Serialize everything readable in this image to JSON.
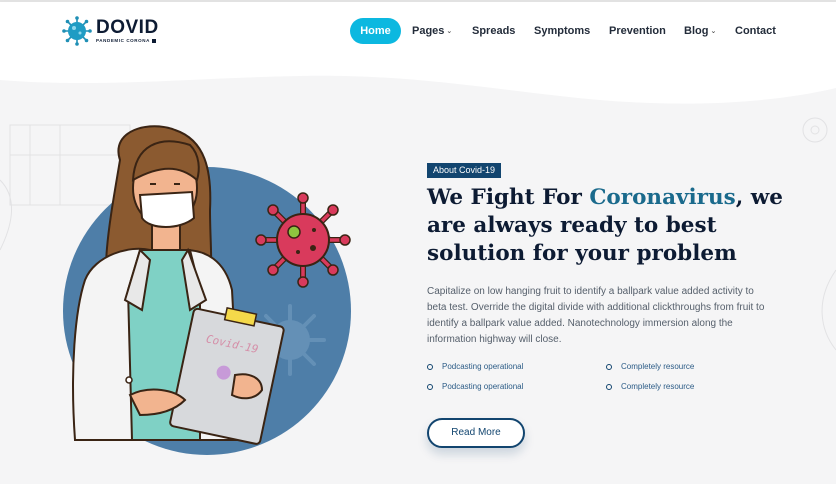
{
  "brand": {
    "name": "DOVID",
    "tagline": "PANDEMIC CORONA"
  },
  "nav": {
    "items": [
      {
        "label": "Home",
        "active": true
      },
      {
        "label": "Pages",
        "dropdown": true
      },
      {
        "label": "Spreads"
      },
      {
        "label": "Symptoms"
      },
      {
        "label": "Prevention"
      },
      {
        "label": "Blog",
        "dropdown": true
      },
      {
        "label": "Contact"
      }
    ]
  },
  "hero": {
    "tag": "About Covid-19",
    "title_before": "We Fight For ",
    "title_highlight": "Coronavirus",
    "title_after": ", we are always ready to best solution for your problem",
    "description": "Capitalize on low hanging fruit to identify a ballpark value added activity to beta test. Override the digital divide with additional clickthroughs from fruit to identify a ballpark value added. Nanotechnology immersion along the information highway will close.",
    "features": [
      "Podcasting operational",
      "Completely resource",
      "Podcasting operational",
      "Completely resource"
    ],
    "button_label": "Read More",
    "clipboard_text": "Covid-19"
  },
  "colors": {
    "accent": "#0cb8e0",
    "navy": "#12456f",
    "heading": "#0d1b33",
    "highlight": "#1a6a8c",
    "virus": "#d93a5c",
    "circle": "#4e7ea8"
  },
  "icons": {
    "logo": "virus-icon",
    "caret": "chevron-down-icon",
    "bullet": "ring-bullet-icon"
  }
}
